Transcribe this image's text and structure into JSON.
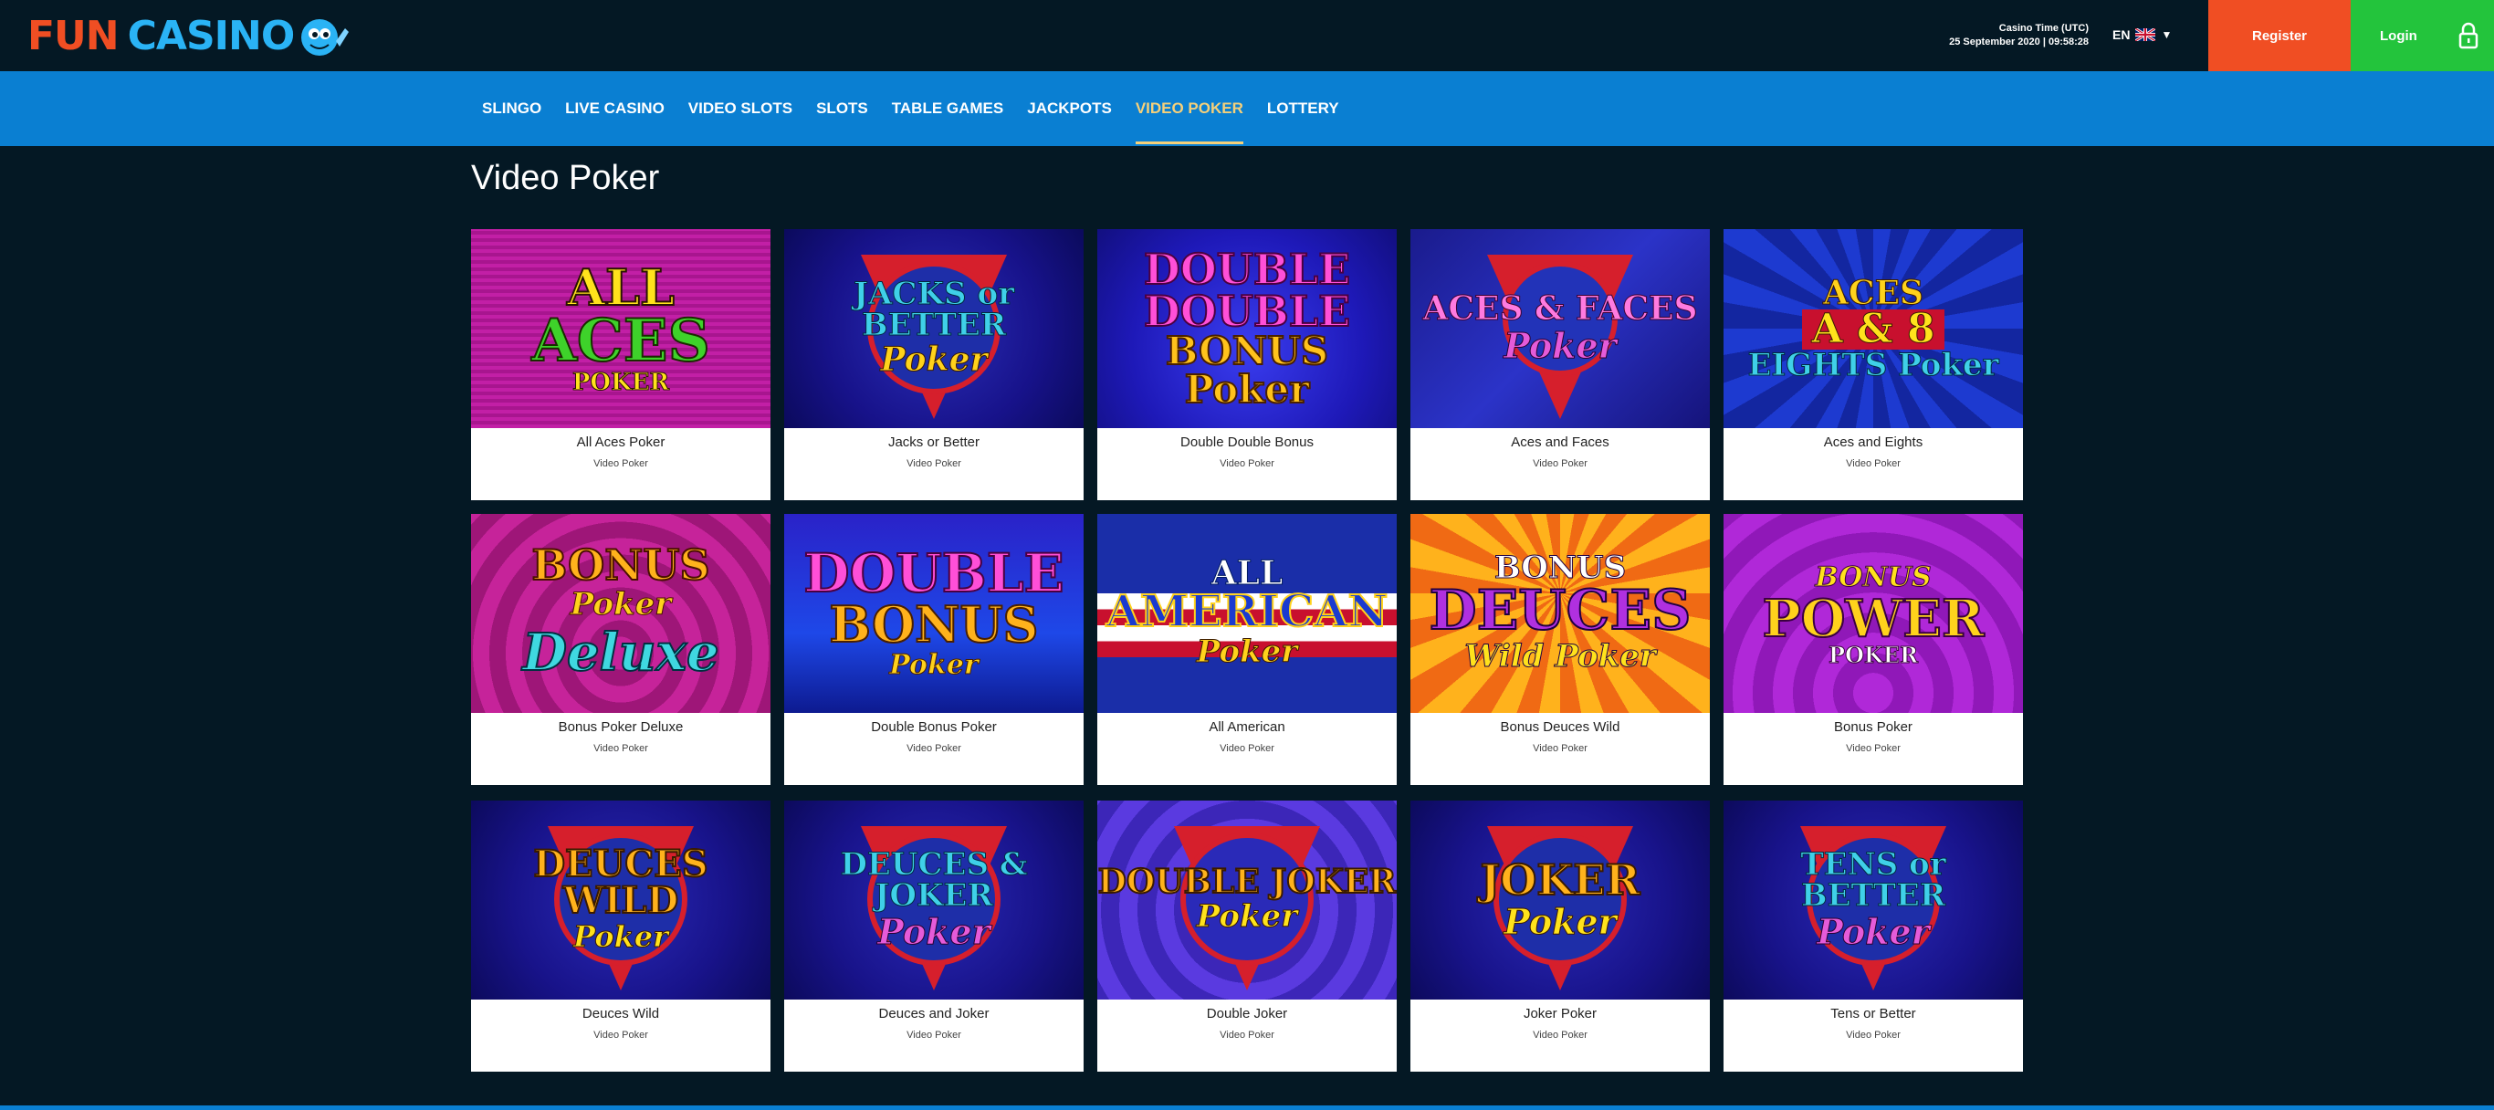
{
  "brand": {
    "word1": "FUN",
    "word2": "CASINO",
    "accent": "#f04e23",
    "secondary": "#2ab3f5"
  },
  "header": {
    "clock_label": "Casino Time (UTC)",
    "clock_value": "25 September 2020 | 09:58:28",
    "language": "EN",
    "flag_icon": "uk-flag-icon",
    "register_label": "Register",
    "login_label": "Login",
    "register_color": "#f04e23",
    "login_color": "#23c43c"
  },
  "nav": {
    "items": [
      "SLINGO",
      "LIVE CASINO",
      "VIDEO SLOTS",
      "SLOTS",
      "TABLE GAMES",
      "JACKPOTS",
      "VIDEO POKER",
      "LOTTERY"
    ],
    "active": "VIDEO POKER",
    "bar_color": "#0a7fd2"
  },
  "page": {
    "title": "Video Poker"
  },
  "games": [
    {
      "title": "All Aces Poker",
      "category": "Video Poker",
      "art_line1": "ALL",
      "art_line2": "ACES",
      "art_line3": "POKER"
    },
    {
      "title": "Jacks or Better",
      "category": "Video Poker",
      "art_line1": "JACKS or BETTER",
      "art_line2": "Poker",
      "art_line3": ""
    },
    {
      "title": "Double Double Bonus",
      "category": "Video Poker",
      "art_line1": "DOUBLE",
      "art_line2": "DOUBLE",
      "art_line3": "BONUS Poker"
    },
    {
      "title": "Aces and Faces",
      "category": "Video Poker",
      "art_line1": "ACES & FACES",
      "art_line2": "Poker",
      "art_line3": ""
    },
    {
      "title": "Aces and Eights",
      "category": "Video Poker",
      "art_line1": "ACES",
      "art_line2": "A & 8",
      "art_line3": "EIGHTS Poker"
    },
    {
      "title": "Bonus Poker Deluxe",
      "category": "Video Poker",
      "art_line1": "BONUS",
      "art_line2": "Poker",
      "art_line3": "Deluxe"
    },
    {
      "title": "Double Bonus Poker",
      "category": "Video Poker",
      "art_line1": "DOUBLE",
      "art_line2": "BONUS",
      "art_line3": "Poker"
    },
    {
      "title": "All American",
      "category": "Video Poker",
      "art_line1": "ALL",
      "art_line2": "AMERICAN",
      "art_line3": "Poker"
    },
    {
      "title": "Bonus Deuces Wild",
      "category": "Video Poker",
      "art_line1": "BONUS",
      "art_line2": "DEUCES",
      "art_line3": "Wild Poker"
    },
    {
      "title": "Bonus Poker",
      "category": "Video Poker",
      "art_line1": "BONUS",
      "art_line2": "POWER",
      "art_line3": "POKER"
    },
    {
      "title": "Deuces Wild",
      "category": "Video Poker",
      "art_line1": "DEUCES WILD",
      "art_line2": "Poker",
      "art_line3": ""
    },
    {
      "title": "Deuces and Joker",
      "category": "Video Poker",
      "art_line1": "DEUCES & JOKER",
      "art_line2": "Poker",
      "art_line3": ""
    },
    {
      "title": "Double Joker",
      "category": "Video Poker",
      "art_line1": "DOUBLE JOKER",
      "art_line2": "Poker",
      "art_line3": ""
    },
    {
      "title": "Joker Poker",
      "category": "Video Poker",
      "art_line1": "JOKER",
      "art_line2": "Poker",
      "art_line3": ""
    },
    {
      "title": "Tens or Better",
      "category": "Video Poker",
      "art_line1": "TENS or BETTER",
      "art_line2": "Poker",
      "art_line3": ""
    }
  ]
}
